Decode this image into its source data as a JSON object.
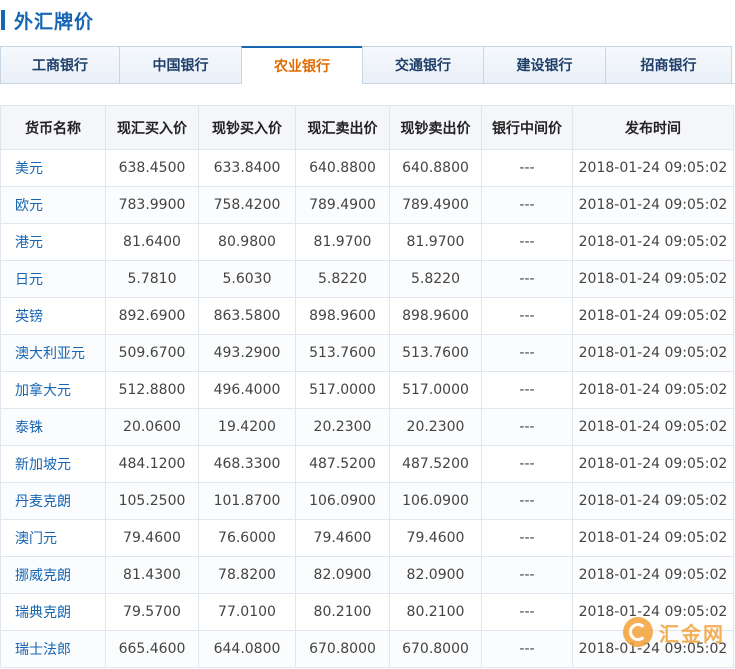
{
  "header": {
    "title": "外汇牌价"
  },
  "tabs": [
    {
      "label": "工商银行",
      "active": false
    },
    {
      "label": "中国银行",
      "active": false
    },
    {
      "label": "农业银行",
      "active": true
    },
    {
      "label": "交通银行",
      "active": false
    },
    {
      "label": "建设银行",
      "active": false
    },
    {
      "label": "招商银行",
      "active": false
    }
  ],
  "table": {
    "columns": [
      "货币名称",
      "现汇买入价",
      "现钞买入价",
      "现汇卖出价",
      "现钞卖出价",
      "银行中间价",
      "发布时间"
    ],
    "rows": [
      [
        "美元",
        "638.4500",
        "633.8400",
        "640.8800",
        "640.8800",
        "---",
        "2018-01-24 09:05:02"
      ],
      [
        "欧元",
        "783.9900",
        "758.4200",
        "789.4900",
        "789.4900",
        "---",
        "2018-01-24 09:05:02"
      ],
      [
        "港元",
        "81.6400",
        "80.9800",
        "81.9700",
        "81.9700",
        "---",
        "2018-01-24 09:05:02"
      ],
      [
        "日元",
        "5.7810",
        "5.6030",
        "5.8220",
        "5.8220",
        "---",
        "2018-01-24 09:05:02"
      ],
      [
        "英镑",
        "892.6900",
        "863.5800",
        "898.9600",
        "898.9600",
        "---",
        "2018-01-24 09:05:02"
      ],
      [
        "澳大利亚元",
        "509.6700",
        "493.2900",
        "513.7600",
        "513.7600",
        "---",
        "2018-01-24 09:05:02"
      ],
      [
        "加拿大元",
        "512.8800",
        "496.4000",
        "517.0000",
        "517.0000",
        "---",
        "2018-01-24 09:05:02"
      ],
      [
        "泰铢",
        "20.0600",
        "19.4200",
        "20.2300",
        "20.2300",
        "---",
        "2018-01-24 09:05:02"
      ],
      [
        "新加坡元",
        "484.1200",
        "468.3300",
        "487.5200",
        "487.5200",
        "---",
        "2018-01-24 09:05:02"
      ],
      [
        "丹麦克朗",
        "105.2500",
        "101.8700",
        "106.0900",
        "106.0900",
        "---",
        "2018-01-24 09:05:02"
      ],
      [
        "澳门元",
        "79.4600",
        "76.6000",
        "79.4600",
        "79.4600",
        "---",
        "2018-01-24 09:05:02"
      ],
      [
        "挪威克朗",
        "81.4300",
        "78.8200",
        "82.0900",
        "82.0900",
        "---",
        "2018-01-24 09:05:02"
      ],
      [
        "瑞典克朗",
        "79.5700",
        "77.0100",
        "80.2100",
        "80.2100",
        "---",
        "2018-01-24 09:05:02"
      ],
      [
        "瑞士法郎",
        "665.4600",
        "644.0800",
        "670.8000",
        "670.8000",
        "---",
        "2018-01-24 09:05:02"
      ]
    ]
  },
  "watermark": {
    "text": "汇金网",
    "icon": "huijin-logo-icon"
  }
}
